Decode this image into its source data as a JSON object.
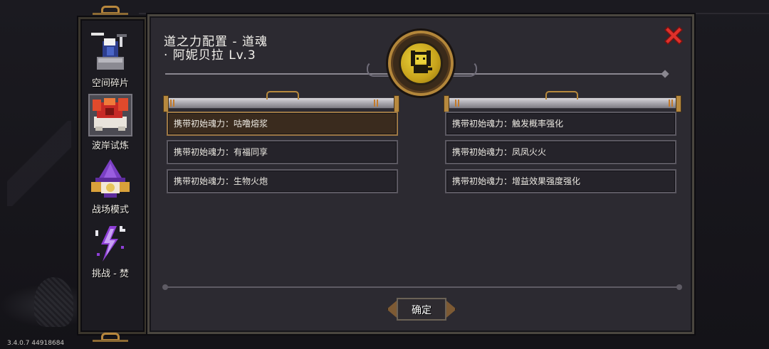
{
  "version": "3.4.0.7 44918684",
  "sidebar": {
    "items": [
      {
        "label": "空间碎片",
        "icon": "space-fragment-icon"
      },
      {
        "label": "波岸试炼",
        "icon": "red-dragon-icon",
        "selected": true
      },
      {
        "label": "战场模式",
        "icon": "wizard-icon"
      },
      {
        "label": "挑战 - 焚",
        "icon": "lightning-icon"
      }
    ]
  },
  "panel": {
    "title_line1": "道之力配置 - 道魂",
    "title_line2": "· 阿妮贝拉 Lv.3",
    "close_icon": "close-x-icon",
    "emblem_icon": "character-portrait-icon",
    "left_entries": [
      {
        "text": "携带初始魂力：咕噜熔浆",
        "active": true
      },
      {
        "text": "携带初始魂力：有福同享",
        "active": false
      },
      {
        "text": "携带初始魂力：生物火炮",
        "active": false
      }
    ],
    "right_entries": [
      {
        "text": "携带初始魂力：触发概率强化",
        "active": false
      },
      {
        "text": "携带初始魂力：凤凤火火",
        "active": false
      },
      {
        "text": "携带初始魂力：增益效果强度强化",
        "active": false
      }
    ],
    "confirm_label": "确定"
  },
  "colors": {
    "panel_bg": "#2c2a31",
    "accent_gold": "#b7893e",
    "close_red": "#e0302a",
    "emblem_yellow": "#e9d23a"
  }
}
